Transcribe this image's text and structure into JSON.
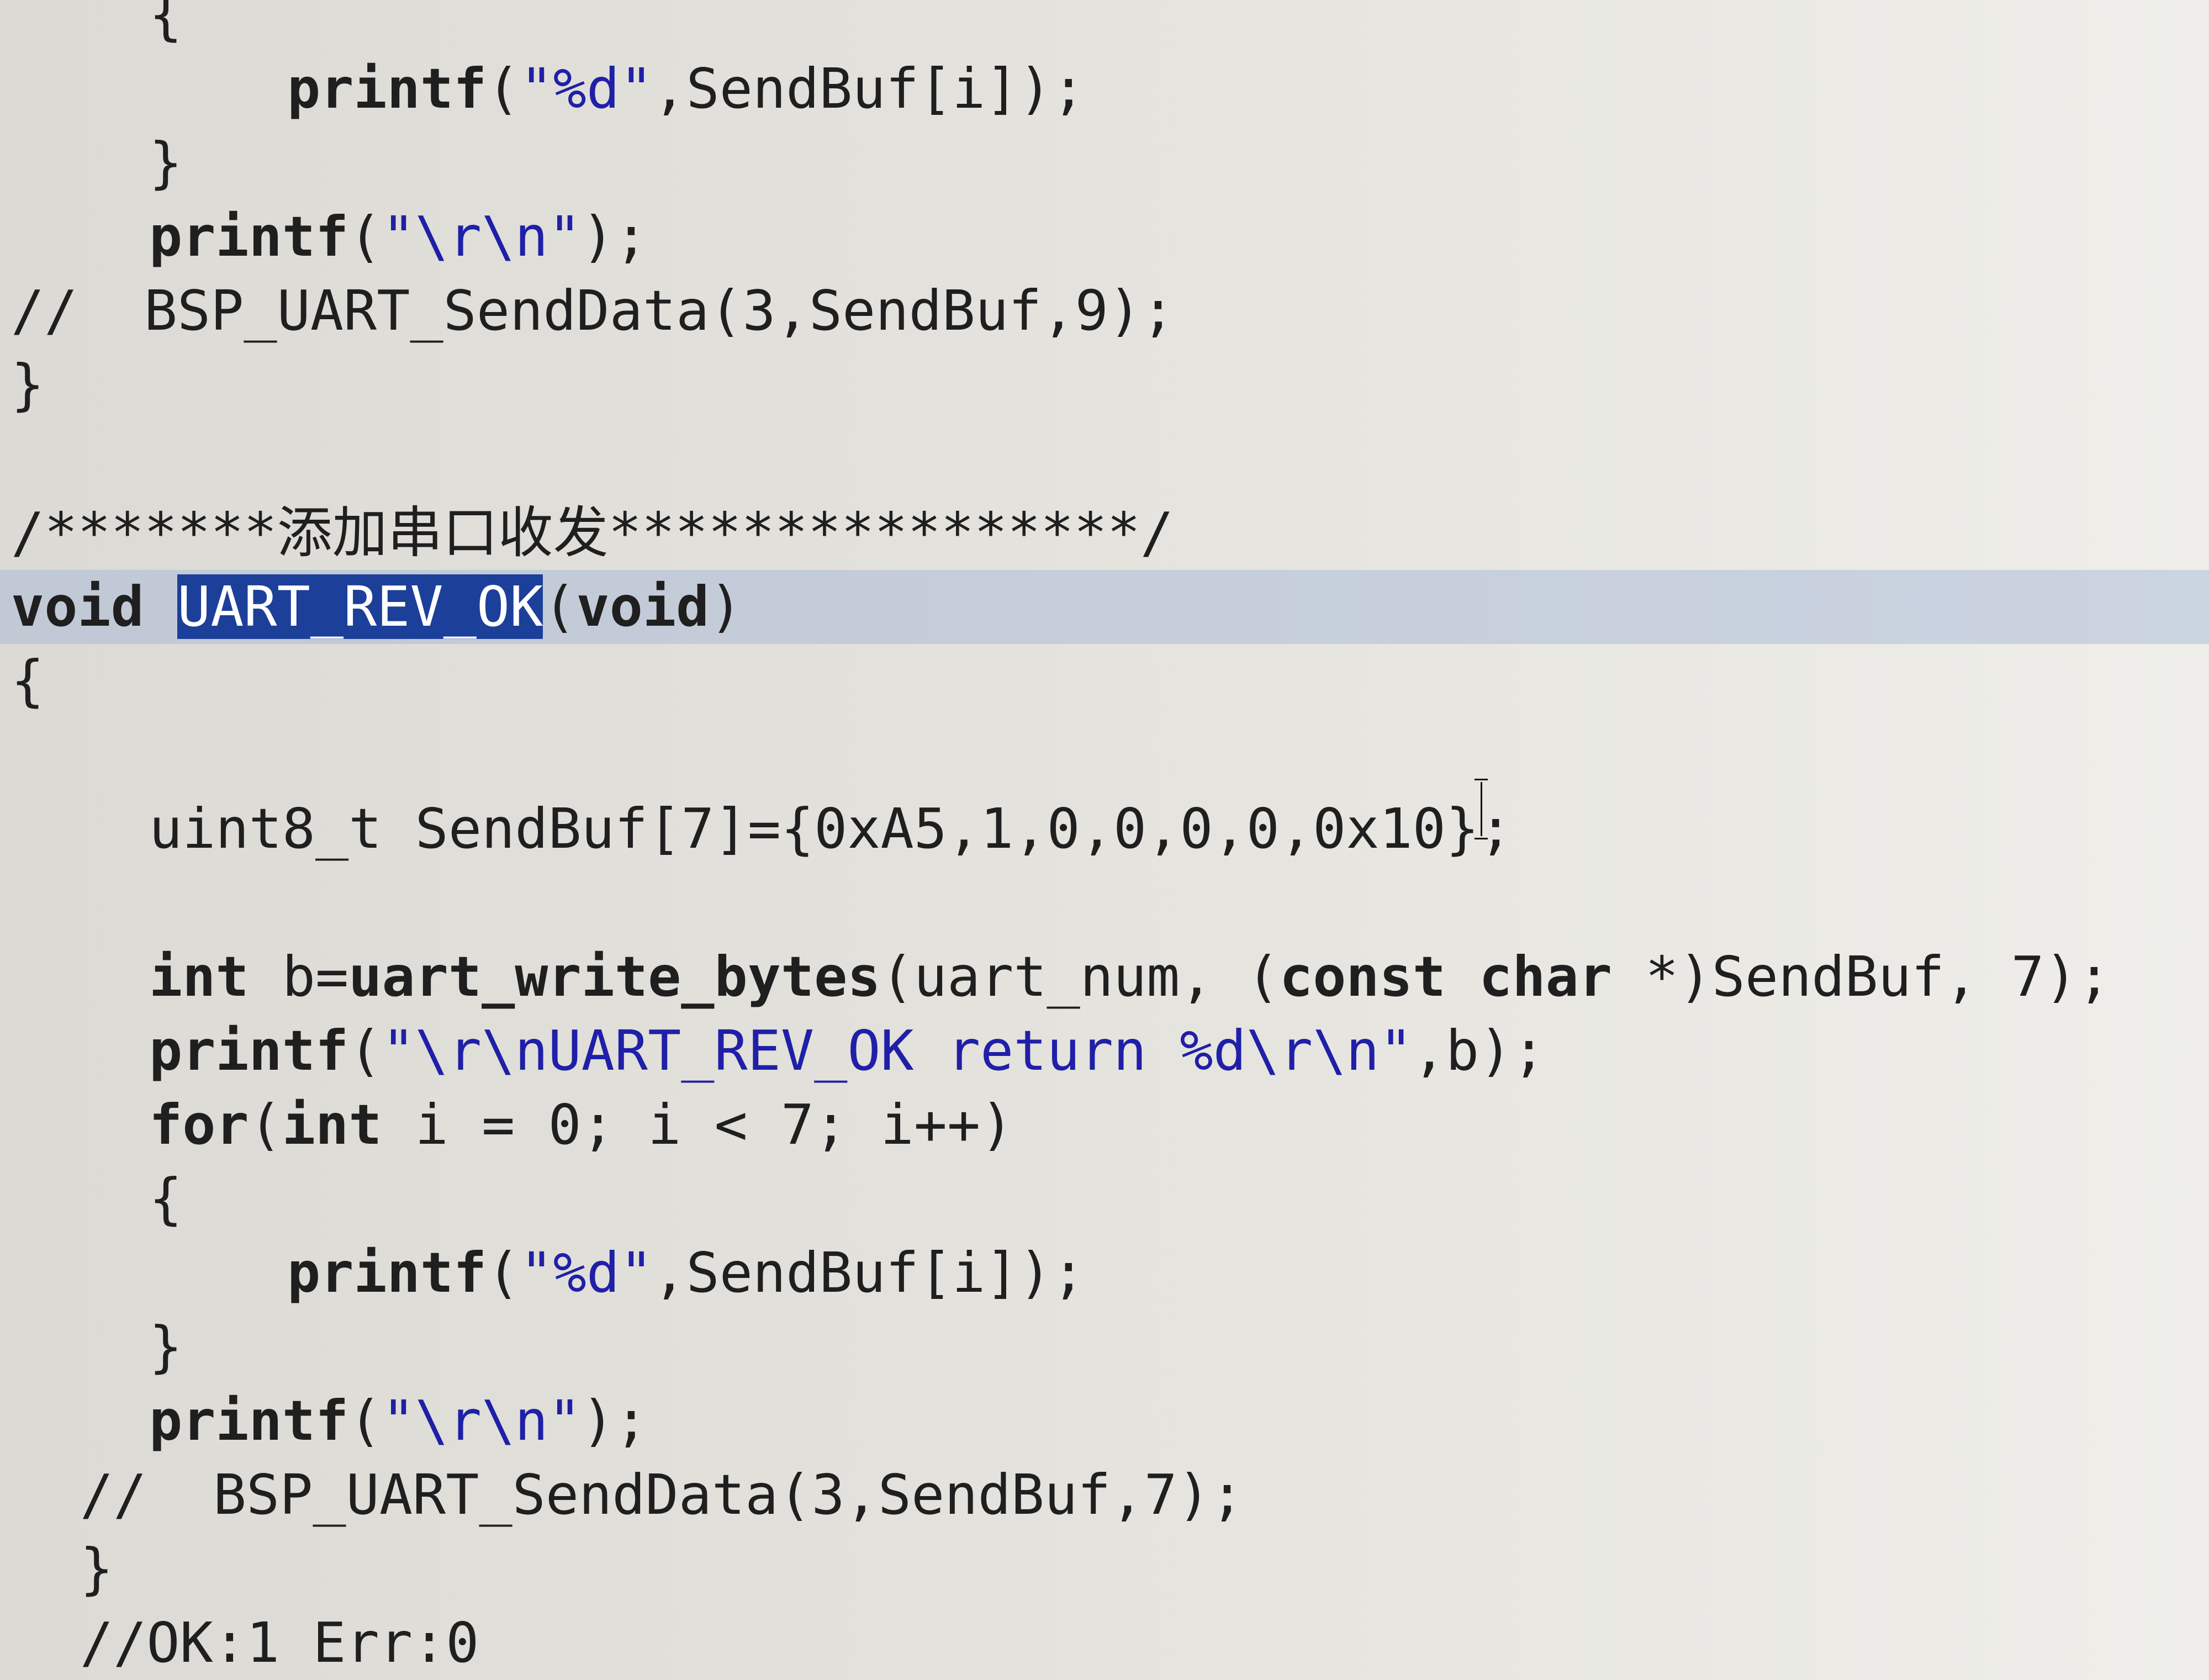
{
  "editor": {
    "lines": [
      {
        "indent": "  ",
        "parts": [
          {
            "cls": "plain",
            "text": "{"
          }
        ]
      },
      {
        "indent": "    ",
        "parts": [
          {
            "cls": "fn",
            "text": "printf"
          },
          {
            "cls": "plain",
            "text": "("
          },
          {
            "cls": "str",
            "text": "\"%d\""
          },
          {
            "cls": "plain",
            "text": ",SendBuf[i]);"
          }
        ]
      },
      {
        "indent": "  ",
        "parts": [
          {
            "cls": "plain",
            "text": "}"
          }
        ]
      },
      {
        "indent": "  ",
        "parts": [
          {
            "cls": "fn",
            "text": "printf"
          },
          {
            "cls": "plain",
            "text": "("
          },
          {
            "cls": "str",
            "text": "\"\\r\\n\""
          },
          {
            "cls": "plain",
            "text": ");"
          }
        ]
      },
      {
        "indent": "",
        "parts": [
          {
            "cls": "cm",
            "text": "//  BSP_UART_SendData(3,SendBuf,9);"
          }
        ]
      },
      {
        "indent": "",
        "parts": [
          {
            "cls": "plain",
            "text": "}"
          }
        ]
      },
      {
        "indent": "",
        "parts": [
          {
            "cls": "plain",
            "text": ""
          }
        ]
      },
      {
        "indent": "",
        "parts": [
          {
            "cls": "cm",
            "text": "/*******添加串口收发****************/"
          }
        ]
      },
      {
        "indent": "",
        "highlight": true,
        "parts": [
          {
            "cls": "kw",
            "text": "void"
          },
          {
            "cls": "plain",
            "text": " "
          },
          {
            "cls": "sel",
            "text": "UART_REV_OK"
          },
          {
            "cls": "plain",
            "text": "("
          },
          {
            "cls": "kw",
            "text": "void"
          },
          {
            "cls": "plain",
            "text": ")"
          }
        ]
      },
      {
        "indent": "",
        "parts": [
          {
            "cls": "plain",
            "text": "{"
          }
        ]
      },
      {
        "indent": "",
        "parts": [
          {
            "cls": "plain",
            "text": ""
          }
        ]
      },
      {
        "indent": "  ",
        "parts": [
          {
            "cls": "plain",
            "text": "uint8_t SendBuf[7]={0xA5,1,0,0,0,0,0x10};"
          }
        ]
      },
      {
        "indent": "",
        "parts": [
          {
            "cls": "plain",
            "text": ""
          }
        ]
      },
      {
        "indent": "  ",
        "parts": [
          {
            "cls": "kw",
            "text": "int"
          },
          {
            "cls": "plain",
            "text": " b="
          },
          {
            "cls": "fn",
            "text": "uart_write_bytes"
          },
          {
            "cls": "plain",
            "text": "(uart_num, ("
          },
          {
            "cls": "kw",
            "text": "const char"
          },
          {
            "cls": "plain",
            "text": " *)SendBuf, 7);"
          }
        ]
      },
      {
        "indent": "  ",
        "parts": [
          {
            "cls": "fn",
            "text": "printf"
          },
          {
            "cls": "plain",
            "text": "("
          },
          {
            "cls": "str",
            "text": "\"\\r\\nUART_REV_OK return %d\\r\\n\""
          },
          {
            "cls": "plain",
            "text": ",b);"
          }
        ]
      },
      {
        "indent": "  ",
        "parts": [
          {
            "cls": "kw",
            "text": "for"
          },
          {
            "cls": "plain",
            "text": "("
          },
          {
            "cls": "kw",
            "text": "int"
          },
          {
            "cls": "plain",
            "text": " i = 0; i < 7; i++)"
          }
        ]
      },
      {
        "indent": "  ",
        "parts": [
          {
            "cls": "plain",
            "text": "{"
          }
        ]
      },
      {
        "indent": "    ",
        "parts": [
          {
            "cls": "fn",
            "text": "printf"
          },
          {
            "cls": "plain",
            "text": "("
          },
          {
            "cls": "str",
            "text": "\"%d\""
          },
          {
            "cls": "plain",
            "text": ",SendBuf[i]);"
          }
        ]
      },
      {
        "indent": "  ",
        "parts": [
          {
            "cls": "plain",
            "text": "}"
          }
        ]
      },
      {
        "indent": "  ",
        "parts": [
          {
            "cls": "fn",
            "text": "printf"
          },
          {
            "cls": "plain",
            "text": "("
          },
          {
            "cls": "str",
            "text": "\"\\r\\n\""
          },
          {
            "cls": "plain",
            "text": ");"
          }
        ]
      },
      {
        "indent": " ",
        "parts": [
          {
            "cls": "cm",
            "text": "//  BSP_UART_SendData(3,SendBuf,7);"
          }
        ]
      },
      {
        "indent": " ",
        "parts": [
          {
            "cls": "plain",
            "text": "}"
          }
        ]
      },
      {
        "indent": " ",
        "parts": [
          {
            "cls": "cm",
            "text": "//OK:1 Err:0"
          }
        ]
      }
    ]
  }
}
